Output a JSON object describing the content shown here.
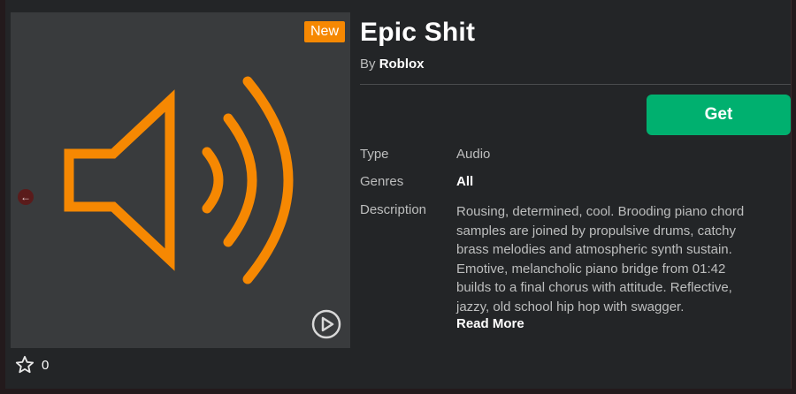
{
  "item": {
    "title": "Epic Shit",
    "by_prefix": "By",
    "creator": "Roblox",
    "badge": "New",
    "get_label": "Get",
    "favorites_count": "0"
  },
  "details": {
    "type_label": "Type",
    "type_value": "Audio",
    "genres_label": "Genres",
    "genres_value": "All",
    "description_label": "Description",
    "description_lines": [
      "Rousing, determined, cool. Brooding piano chord",
      "samples are joined by propulsive drums, catchy",
      "brass melodies and atmospheric synth sustain.",
      "Emotive, melancholic piano bridge from 01:42",
      "builds to a final chorus with attitude. Reflective,",
      "jazzy, old school hip hop with swagger."
    ],
    "read_more": "Read More"
  },
  "colors": {
    "accent_orange": "#f68802",
    "get_green": "#00b06f",
    "panel_bg": "#232527",
    "thumb_bg": "#393b3d"
  },
  "icons": [
    "speaker-icon",
    "play-icon",
    "star-icon",
    "back-arrow-icon"
  ]
}
